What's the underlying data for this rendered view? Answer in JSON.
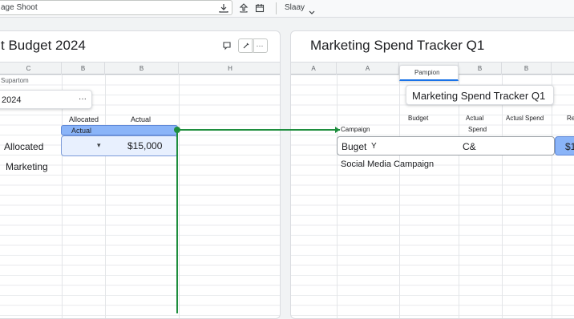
{
  "topbar": {
    "search_text": "age Shoot",
    "menu_label": "Slaay",
    "icons": [
      "download-icon",
      "share-icon",
      "calendar-icon",
      "chevron-down-icon"
    ]
  },
  "left_panel": {
    "title": "t Budget 2024",
    "columns": [
      "C",
      "B",
      "B",
      "H"
    ],
    "row_label_small": "Supartom",
    "year_popup_value": "2024",
    "year_popup_more": "···",
    "header_allocated": "Allocated",
    "header_actual": "Actual",
    "blue_pill_label": "Actual",
    "row_allocated_label": "Allocated",
    "row_allocated_dropdown": "▾",
    "row_allocated_value": "$15,000",
    "row_marketing_label": "Marketing"
  },
  "right_panel": {
    "title": "Marketing Spend Tracker Q1",
    "columns": [
      "A",
      "A",
      "B",
      "B",
      "B"
    ],
    "tab_label": "Pampion",
    "title_popup": "Marketing Spend Tracker Q1",
    "headers": {
      "budget": "Budget",
      "actual": "Actual",
      "actual_spend": "Actusl Spend",
      "re": "Re",
      "campaign": "Campaign",
      "spend": "Spend"
    },
    "input_text": "Buget",
    "input_caret_glyph": "Y",
    "cell_code": "C&",
    "blue_cell_value": "$1",
    "row_campaign": "Social Media Campaign"
  },
  "colors": {
    "connector": "#1e8e3e",
    "selection_blue": "#8ab4f8",
    "selection_fill": "#e8f0fe"
  }
}
